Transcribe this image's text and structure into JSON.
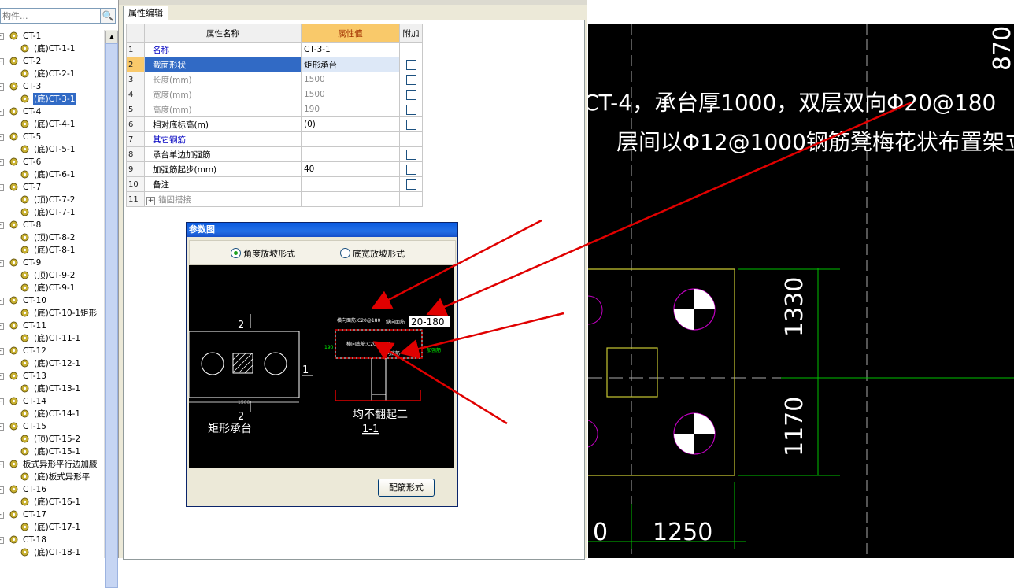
{
  "search": {
    "placeholder": "构件..."
  },
  "tree": [
    {
      "label": "CT-1",
      "level": 0
    },
    {
      "label": "(底)CT-1-1",
      "level": 1
    },
    {
      "label": "CT-2",
      "level": 0
    },
    {
      "label": "(底)CT-2-1",
      "level": 1
    },
    {
      "label": "CT-3",
      "level": 0
    },
    {
      "label": "(底)CT-3-1",
      "level": 1,
      "selected": true
    },
    {
      "label": "CT-4",
      "level": 0
    },
    {
      "label": "(底)CT-4-1",
      "level": 1
    },
    {
      "label": "CT-5",
      "level": 0
    },
    {
      "label": "(底)CT-5-1",
      "level": 1
    },
    {
      "label": "CT-6",
      "level": 0
    },
    {
      "label": "(底)CT-6-1",
      "level": 1
    },
    {
      "label": "CT-7",
      "level": 0
    },
    {
      "label": "(顶)CT-7-2",
      "level": 1
    },
    {
      "label": "(底)CT-7-1",
      "level": 1
    },
    {
      "label": "CT-8",
      "level": 0
    },
    {
      "label": "(顶)CT-8-2",
      "level": 1
    },
    {
      "label": "(底)CT-8-1",
      "level": 1
    },
    {
      "label": "CT-9",
      "level": 0
    },
    {
      "label": "(顶)CT-9-2",
      "level": 1
    },
    {
      "label": "(底)CT-9-1",
      "level": 1
    },
    {
      "label": "CT-10",
      "level": 0
    },
    {
      "label": "(底)CT-10-1矩形",
      "level": 1
    },
    {
      "label": "CT-11",
      "level": 0
    },
    {
      "label": "(底)CT-11-1",
      "level": 1
    },
    {
      "label": "CT-12",
      "level": 0
    },
    {
      "label": "(底)CT-12-1",
      "level": 1
    },
    {
      "label": "CT-13",
      "level": 0
    },
    {
      "label": "(底)CT-13-1",
      "level": 1
    },
    {
      "label": "CT-14",
      "level": 0
    },
    {
      "label": "(底)CT-14-1",
      "level": 1
    },
    {
      "label": "CT-15",
      "level": 0
    },
    {
      "label": "(顶)CT-15-2",
      "level": 1
    },
    {
      "label": "(底)CT-15-1",
      "level": 1
    },
    {
      "label": "板式异形平行边加腋",
      "level": 0
    },
    {
      "label": "(底)板式异形平",
      "level": 1
    },
    {
      "label": "CT-16",
      "level": 0
    },
    {
      "label": "(底)CT-16-1",
      "level": 1
    },
    {
      "label": "CT-17",
      "level": 0
    },
    {
      "label": "(底)CT-17-1",
      "level": 1
    },
    {
      "label": "CT-18",
      "level": 0
    },
    {
      "label": "(底)CT-18-1",
      "level": 1
    }
  ],
  "prop_tab": "属性编辑",
  "prop_headers": {
    "name": "属性名称",
    "value": "属性值",
    "extra": "附加"
  },
  "props": [
    {
      "num": "1",
      "name": "名称",
      "value": "CT-3-1",
      "check": false,
      "style": "blue"
    },
    {
      "num": "2",
      "name": "截面形状",
      "value": "矩形承台",
      "check": true,
      "style": "blue",
      "selected": true
    },
    {
      "num": "3",
      "name": "长度(mm)",
      "value": "1500",
      "check": true,
      "style": "gray"
    },
    {
      "num": "4",
      "name": "宽度(mm)",
      "value": "1500",
      "check": true,
      "style": "gray"
    },
    {
      "num": "5",
      "name": "高度(mm)",
      "value": "190",
      "check": true,
      "style": "gray"
    },
    {
      "num": "6",
      "name": "相对底标高(m)",
      "value": "(0)",
      "check": true,
      "style": "dark"
    },
    {
      "num": "7",
      "name": "其它钢筋",
      "value": "",
      "check": false,
      "style": "blue"
    },
    {
      "num": "8",
      "name": "承台单边加强筋",
      "value": "",
      "check": true,
      "style": "dark"
    },
    {
      "num": "9",
      "name": "加强筋起步(mm)",
      "value": "40",
      "check": true,
      "style": "dark"
    },
    {
      "num": "10",
      "name": "备注",
      "value": "",
      "check": true,
      "style": "dark"
    },
    {
      "num": "11",
      "name": "锚固搭接",
      "value": "",
      "check": false,
      "style": "gray",
      "expand": true
    }
  ],
  "dialog": {
    "title": "参数图",
    "radio1": "角度放坡形式",
    "radio2": "底宽放坡形式",
    "button": "配筋形式",
    "diagram": {
      "top_label": "2",
      "bottom_label": "2",
      "right_label": "1",
      "dim": "1500",
      "caption_left": "矩形承台",
      "caption_right": "均不翻起二",
      "section": "1-1",
      "callout": "20-180",
      "small_top": "横向面筋:C20@180",
      "small_top2": "纵向面筋",
      "small_mid": "横向底筋:C20@180",
      "small_mid2": "纵向底筋",
      "height_label": "190",
      "side_label": "加强筋"
    }
  },
  "cad": {
    "line1": "CT-4，承台厚1000，双层双向Φ20@180",
    "line2": "层间以Φ12@1000钢筋凳梅花状布置架立",
    "dim1": "1330",
    "dim2": "1170",
    "dim3": "1250",
    "dim4": "0",
    "dim_top": "870"
  },
  "colors": {
    "selection": "#316ac5",
    "header_accent": "#f9c96a",
    "arrow": "#e00000",
    "cad_green": "#00c000",
    "cad_yellow": "#c8c832",
    "cad_magenta": "#c000c0"
  }
}
